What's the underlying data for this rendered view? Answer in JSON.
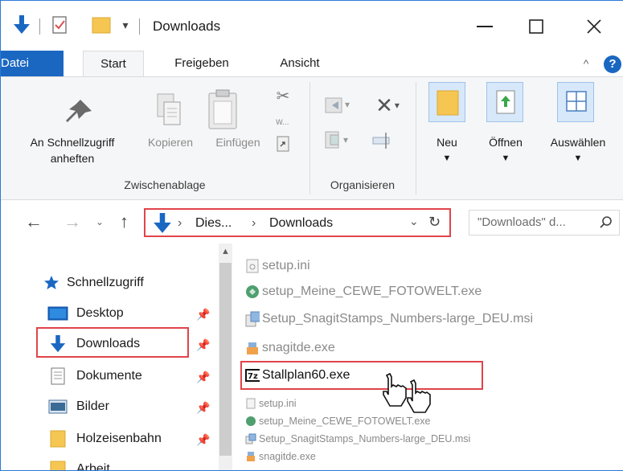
{
  "window": {
    "title": "Downloads"
  },
  "ribbon_tabs": [
    {
      "label": "Datei"
    },
    {
      "label": "Start"
    },
    {
      "label": "Freigeben"
    },
    {
      "label": "Ansicht"
    }
  ],
  "ribbon": {
    "pin_label_line1": "An Schnellzugriff",
    "pin_label_line2": "anheften",
    "copy_label": "Kopieren",
    "paste_label": "Einfügen",
    "clipboard_group": "Zwischenablage",
    "organize_group": "Organisieren",
    "new_label": "Neu",
    "open_label": "Öffnen",
    "select_label": "Auswählen"
  },
  "address": {
    "crumb1": "Dies...",
    "crumb2": "Downloads",
    "search_placeholder": "\"Downloads\" d..."
  },
  "nav": {
    "quick_access": "Schnellzugriff",
    "items": [
      {
        "label": "Desktop"
      },
      {
        "label": "Downloads"
      },
      {
        "label": "Dokumente"
      },
      {
        "label": "Bilder"
      },
      {
        "label": "Holzeisenbahn"
      },
      {
        "label": "Arbeit"
      }
    ]
  },
  "files_large": [
    {
      "name": "setup.ini"
    },
    {
      "name": "setup_Meine_CEWE_FOTOWELT.exe"
    },
    {
      "name": "Setup_SnagitStamps_Numbers-large_DEU.msi"
    },
    {
      "name": "snagitde.exe"
    },
    {
      "name": "Stallplan60.exe"
    }
  ],
  "files_small": [
    {
      "name": "setup.ini"
    },
    {
      "name": "setup_Meine_CEWE_FOTOWELT.exe"
    },
    {
      "name": "Setup_SnagitStamps_Numbers-large_DEU.msi"
    },
    {
      "name": "snagitde.exe"
    }
  ],
  "colors": {
    "accent": "#1a67c2",
    "highlight": "#e0444a",
    "folder": "#f6c653"
  }
}
